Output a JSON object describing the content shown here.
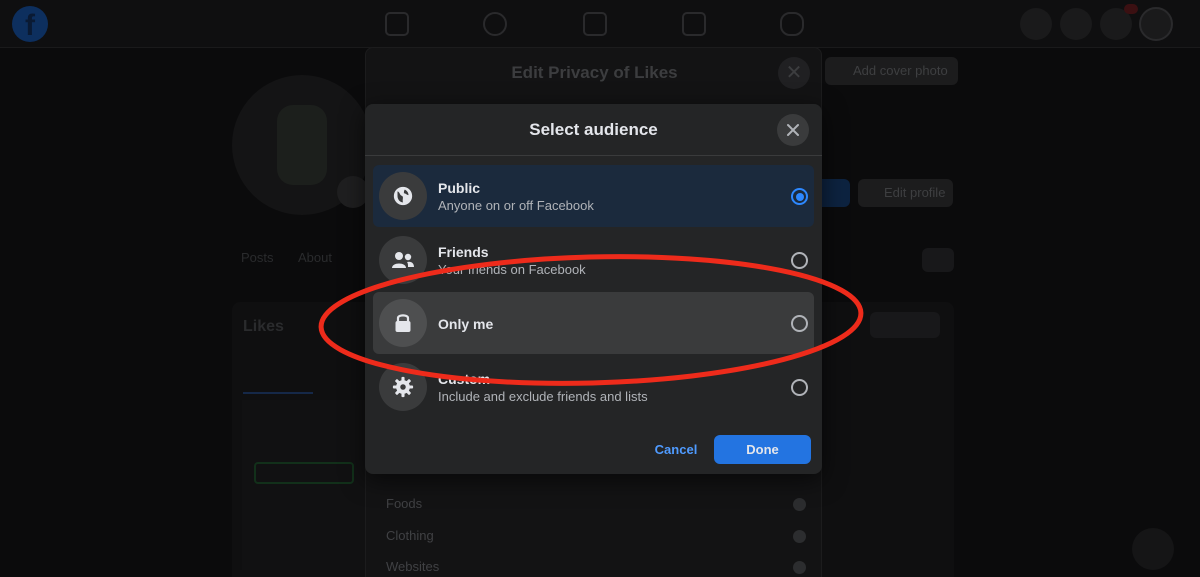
{
  "background": {
    "cover_button": "Add cover photo",
    "edit_profile_button": "Edit profile",
    "tabs": [
      "Posts",
      "About"
    ],
    "likes_title": "Likes",
    "likes_categories": [
      "Foods",
      "Clothing",
      "Websites"
    ]
  },
  "outer_modal": {
    "title": "Edit Privacy of Likes"
  },
  "dialog": {
    "title": "Select audience",
    "options": [
      {
        "label": "Public",
        "sub": "Anyone on or off Facebook",
        "icon": "globe-icon",
        "selected": true
      },
      {
        "label": "Friends",
        "sub": "Your friends on Facebook",
        "icon": "friends-icon",
        "selected": false
      },
      {
        "label": "Only me",
        "sub": "",
        "icon": "lock-icon",
        "selected": false
      },
      {
        "label": "Custom",
        "sub": "Include and exclude friends and lists",
        "icon": "gear-icon",
        "selected": false
      }
    ],
    "cancel_label": "Cancel",
    "done_label": "Done"
  },
  "colors": {
    "accent": "#2d88ff",
    "primary_button": "#2374e1",
    "annotation": "#ee2b1b"
  }
}
